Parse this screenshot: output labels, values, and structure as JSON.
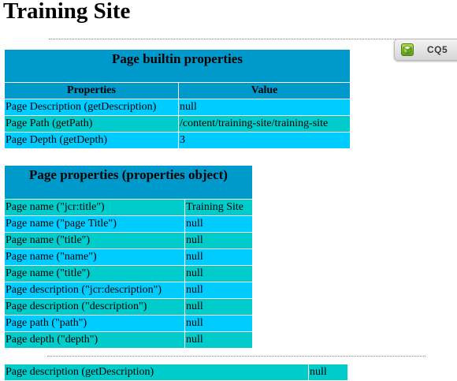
{
  "page": {
    "title": "Training Site"
  },
  "cq_badge": {
    "label": "CQ5",
    "icon": "cube-icon"
  },
  "builtin_table": {
    "caption": "Page builtin properties",
    "headers": [
      "Properties",
      "Value"
    ],
    "rows": [
      [
        "Page Description (getDescription)",
        "null"
      ],
      [
        "Page Path (getPath)",
        "/content/training-site/training-site"
      ],
      [
        "Page Depth (getDepth)",
        "3"
      ]
    ]
  },
  "properties_table": {
    "caption": "Page properties (properties object)",
    "rows": [
      [
        "Page name (\"jcr:title\")",
        "Training Site"
      ],
      [
        "Page name (\"page Title\")",
        "null"
      ],
      [
        "Page name (\"title\")",
        "null"
      ],
      [
        "Page name (\"name\")",
        "null"
      ],
      [
        "Page name (\"title\")",
        "null"
      ],
      [
        "Page description (\"jcr:description\")",
        "null"
      ],
      [
        "Page description (\"description\")",
        "null"
      ],
      [
        "Page path (\"path\")",
        "null"
      ],
      [
        "Page depth (\"depth\")",
        "null"
      ]
    ]
  },
  "lower_table": {
    "rows": [
      [
        "Page description (getDescription)",
        "null"
      ]
    ]
  },
  "colors": {
    "header_blue": "#0099cc",
    "row_light": "#00ccff",
    "row_teal": "#00cccc",
    "badge_green": "#7fbf2a"
  }
}
